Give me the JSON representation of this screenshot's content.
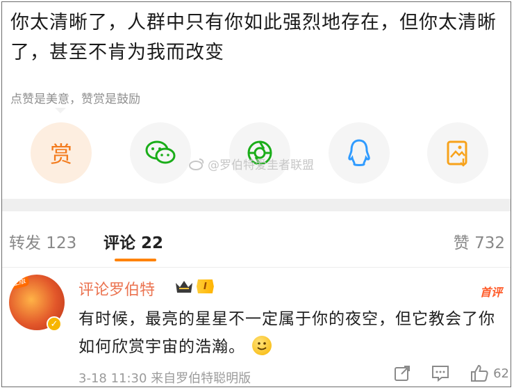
{
  "post": {
    "text": "你太清晰了，人群中只有你如此强烈地存在，但你太清晰了，甚至不肯为我而改变"
  },
  "reward": {
    "tip": "点赞是美意，赞赏是鼓励",
    "button_label": "赏"
  },
  "share": {
    "items": [
      {
        "icon": "reward-icon"
      },
      {
        "icon": "wechat-icon",
        "color": "#1aad19"
      },
      {
        "icon": "moments-icon",
        "color": "#1aad19"
      },
      {
        "icon": "qq-icon",
        "color": "#2f9bff"
      },
      {
        "icon": "save-image-icon",
        "color": "#f7a21b"
      }
    ]
  },
  "watermark": {
    "text": "@罗伯特爱圭者联盟"
  },
  "tabs": {
    "repost": "转发 123",
    "comments": "评论 22",
    "likes": "赞 732"
  },
  "comment": {
    "username": "评论罗伯特",
    "level": "I",
    "top_tag": "首评",
    "avatar_badge": "正版",
    "text": "有时候，最亮的星星不一定属于你的夜空，但它教会了你如何欣赏宇宙的浩瀚。",
    "meta": "3-18 11:30  来自罗伯特聪明版",
    "like_count": "62"
  },
  "colors": {
    "accent": "#ff8200",
    "username": "#eb7350",
    "top_tag": "#ff5b29"
  }
}
